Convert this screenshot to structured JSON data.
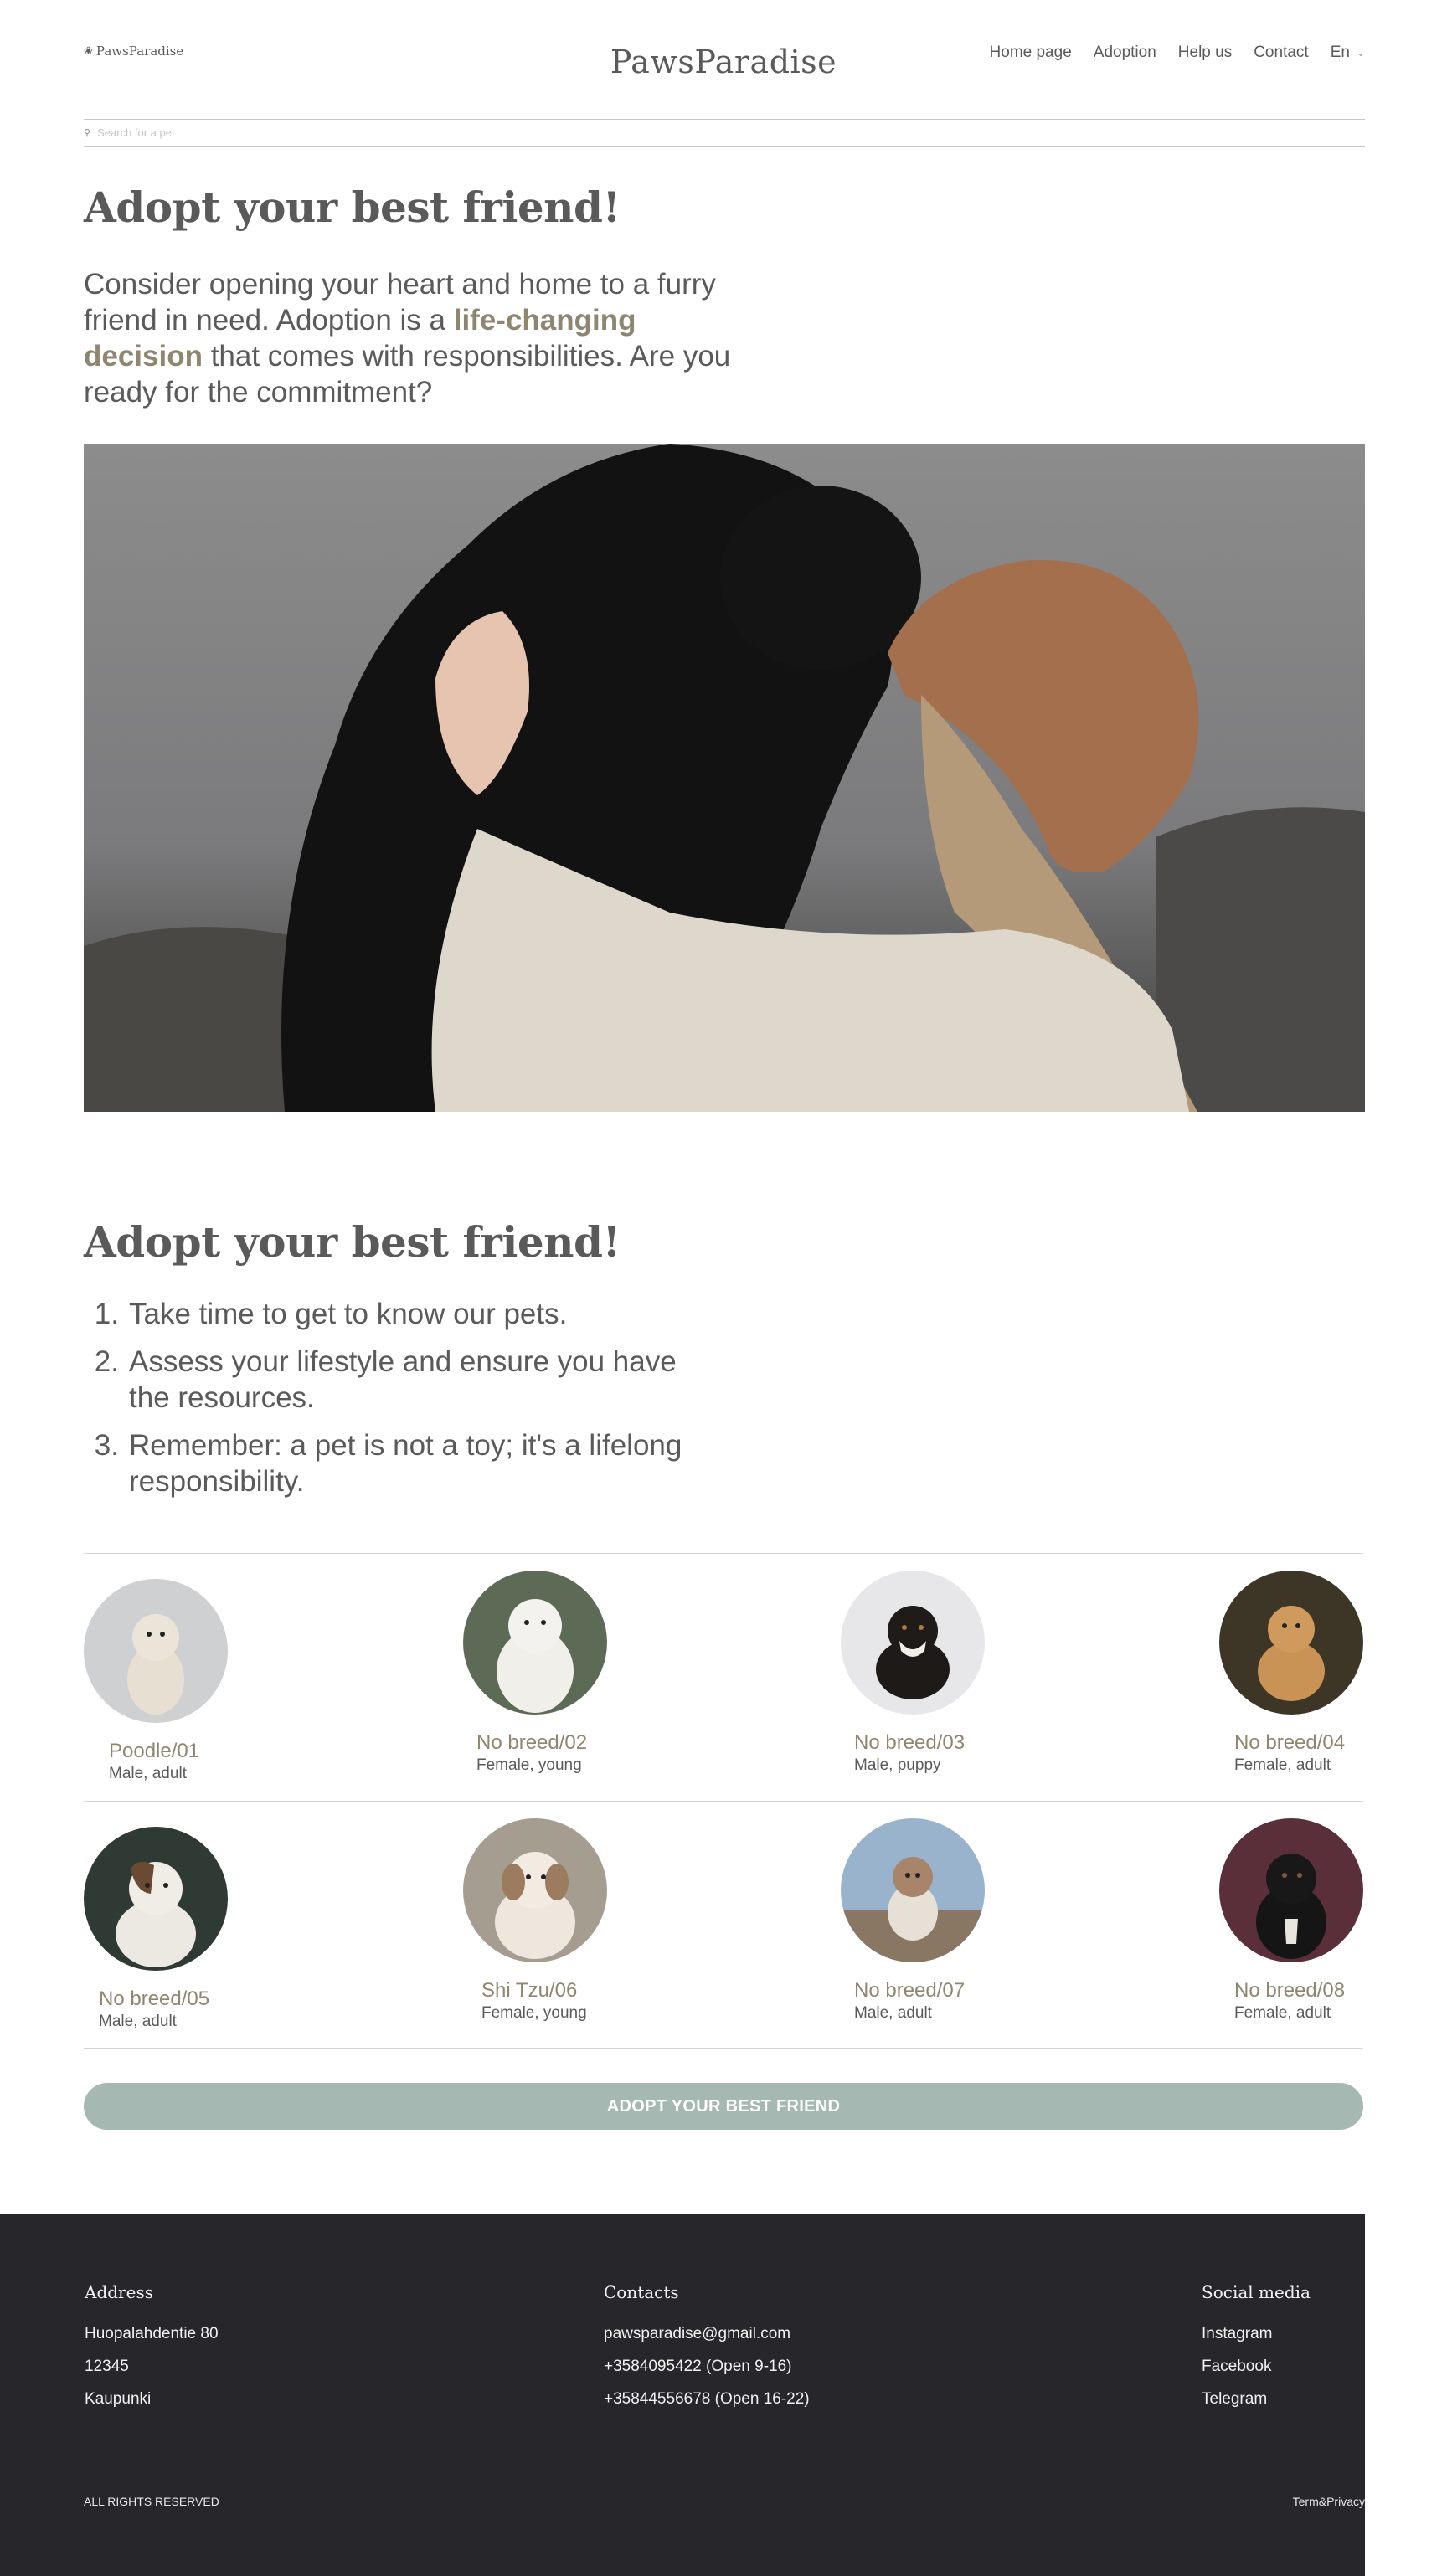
{
  "header": {
    "logo_small": "PawsParadise",
    "brand": "PawsParadise",
    "nav": [
      "Home page",
      "Adoption",
      "Help us",
      "Contact"
    ],
    "language": "En"
  },
  "search": {
    "placeholder": "Search for a pet"
  },
  "section1": {
    "title": "Adopt your best friend!",
    "intro_before": "Consider opening your heart and home to a furry friend in need. Adoption is a ",
    "intro_highlight": "life-changing decision",
    "intro_after": " that comes with responsibilities. Are you ready for the commitment?"
  },
  "section2": {
    "title": "Adopt your best friend!",
    "steps": [
      "Take time to get to know our pets.",
      "Assess your lifestyle and ensure you have the resources.",
      "Remember: a pet is not a toy; it's a lifelong responsibility."
    ]
  },
  "pets": [
    {
      "name": "Poodle/01",
      "desc": "Male, adult"
    },
    {
      "name": "No breed/02",
      "desc": "Female, young"
    },
    {
      "name": "No breed/03",
      "desc": "Male, puppy"
    },
    {
      "name": "No breed/04",
      "desc": "Female, adult"
    },
    {
      "name": "No breed/05",
      "desc": "Male, adult"
    },
    {
      "name": "Shi Tzu/06",
      "desc": "Female, young"
    },
    {
      "name": "No breed/07",
      "desc": "Male, adult"
    },
    {
      "name": "No breed/08",
      "desc": "Female, adult"
    }
  ],
  "cta": {
    "label": "ADOPT YOUR BEST FRIEND",
    "color": "#a5b8b1"
  },
  "footer": {
    "address_title": "Address",
    "address": [
      "Huopalahdentie 80",
      "12345",
      "Kaupunki"
    ],
    "contacts_title": "Contacts",
    "contacts": [
      "pawsparadise@gmail.com",
      "+3584095422 (Open 9-16)",
      "+35844556678 (Open 16-22)"
    ],
    "social_title": "Social media",
    "social": [
      "Instagram",
      "Facebook",
      "Telegram"
    ],
    "rights": "ALL RIGHTS RESERVED",
    "terms": "Term&Privacy"
  },
  "colors": {
    "accent": "#8e8670",
    "text": "#5a5a5a",
    "footer_bg": "#27272b"
  }
}
